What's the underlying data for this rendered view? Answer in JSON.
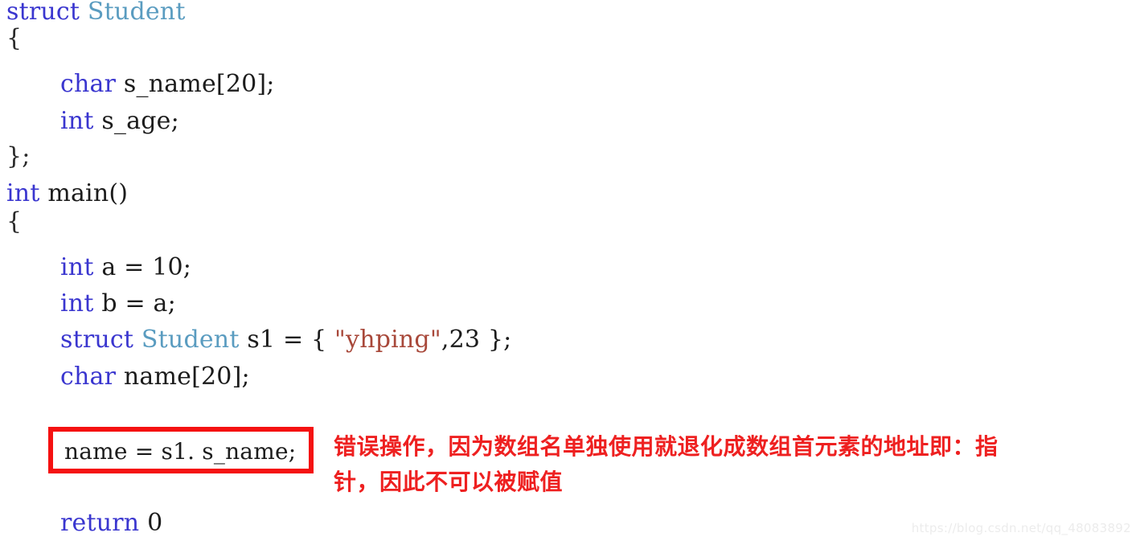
{
  "document": {
    "kind": "c-source-code-snippet",
    "language": "C",
    "background_color": "#ffffff"
  },
  "palette": {
    "keyword": "#3a36cf",
    "type_identifier": "#5a9cc0",
    "string_literal": "#a8483a",
    "plain_text": "#1c1c1c",
    "annotation_red": "#ee2020",
    "highlight_border": "#f51111",
    "watermark": "#ececec"
  },
  "code": {
    "line_01": {
      "kw": "struct",
      "sp1": " ",
      "type": "Student"
    },
    "line_02": {
      "text": "{"
    },
    "line_03": {
      "kw": "char",
      "sp1": " ",
      "rest": "s_name[20];"
    },
    "line_04": {
      "kw": "int",
      "sp1": " ",
      "rest": "s_age;"
    },
    "line_05": {
      "text": "};"
    },
    "line_06": {
      "kw": "int",
      "sp1": " ",
      "rest": "main()"
    },
    "line_07": {
      "text": "{"
    },
    "line_08": {
      "kw": "int",
      "sp1": " ",
      "rest": "a = 10;"
    },
    "line_09": {
      "kw": "int",
      "sp1": " ",
      "rest": "b = a;"
    },
    "line_10": {
      "kw": "struct",
      "sp1": " ",
      "type": "Student",
      "mid": " s1 = { ",
      "str": "\"yhping\"",
      "tail": ",23 };"
    },
    "line_11": {
      "kw": "char",
      "sp1": " ",
      "rest": "name[20];"
    },
    "line_12": {
      "kw": "return",
      "sp1": " ",
      "rest": "0"
    }
  },
  "highlight": {
    "statement": "name = s1. s_name;"
  },
  "annotation": {
    "line_1": "错误操作，因为数组名单独使用就退化成数组首元素的地址即：指",
    "line_2": "针，因此不可以被赋值"
  },
  "watermark": {
    "text": "https://blog.csdn.net/qq_48083892"
  }
}
